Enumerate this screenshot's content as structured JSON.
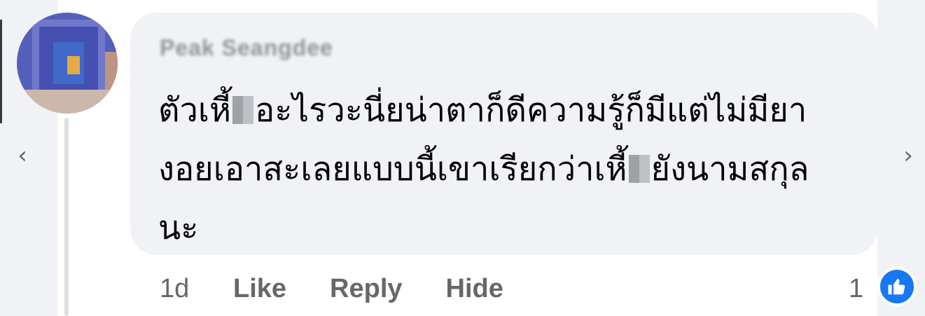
{
  "comment": {
    "author": "Peak Seangdee",
    "text_lines": [
      [
        "ตัวเหี้",
        "อะไรวะนี่ยน่าตาก็ดีความรู้ก็มีแต่ไม่มียา"
      ],
      [
        "งอยเอาสะเลยแบบนี้เขาเรียกว่าเหี้",
        "ยังนามสกุล"
      ],
      [
        "นะ",
        ""
      ]
    ],
    "timestamp": "1d",
    "actions": {
      "like": "Like",
      "reply": "Reply",
      "hide": "Hide"
    },
    "reaction_count": "1"
  },
  "navigation": {
    "prev": "‹",
    "next": "›"
  },
  "colors": {
    "like_blue": "#1877f2",
    "bubble_bg": "#f0f2f5",
    "meta_text": "#65676b"
  },
  "icons": {
    "reaction": "thumbs-up-icon",
    "avatar": "blurred-profile-avatar"
  }
}
